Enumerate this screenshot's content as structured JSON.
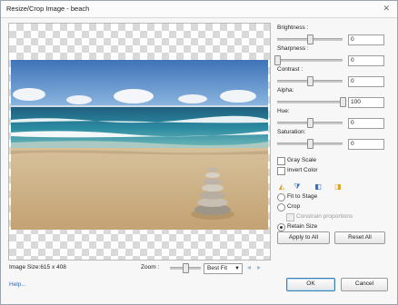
{
  "window": {
    "title": "Resize/Crop Image - beach",
    "close_glyph": "✕"
  },
  "adjustments": [
    {
      "label": "Brightness :",
      "value": "0",
      "level": 0.5
    },
    {
      "label": "Sharpness :",
      "value": "0",
      "level": 0.0
    },
    {
      "label": "Contrast :",
      "value": "0",
      "level": 0.5
    },
    {
      "label": "Alpha:",
      "value": "100",
      "level": 1.0
    },
    {
      "label": "Hue:",
      "value": "0",
      "level": 0.5
    },
    {
      "label": "Saturation:",
      "value": "0",
      "level": 0.5
    }
  ],
  "options": {
    "gray_scale": "Gray Scale",
    "invert_color": "Invert Color",
    "fit_to_stage": "Fit to Stage",
    "crop": "Crop",
    "constrain_proportions": "Constrain proportions",
    "retain_size": "Retain Size",
    "selected_mode": "retain_size"
  },
  "buttons": {
    "apply_to_all": "Apply to All",
    "reset_all": "Reset All",
    "ok": "OK",
    "cancel": "Cancel"
  },
  "status": {
    "image_size": "Image Size:615 x 408",
    "zoom_label": "Zoom :",
    "zoom_level": 0.5,
    "zoom_mode": "Best Fit",
    "help": "Help..."
  },
  "icons": {
    "flip_horizontal": "flip-horizontal-icon",
    "flip_vertical": "flip-vertical-icon",
    "rotate_left": "rotate-left-icon",
    "rotate_right": "rotate-right-icon",
    "undo": "undo-icon",
    "redo": "redo-icon"
  },
  "colors": {
    "link": "#2a6bbd",
    "accent": "#3c7fb1"
  }
}
